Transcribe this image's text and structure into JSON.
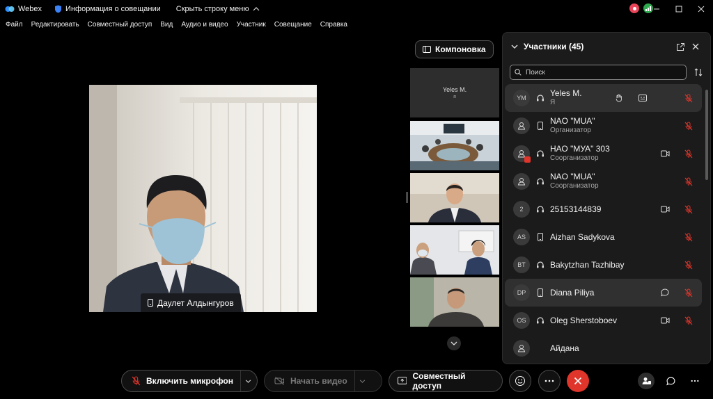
{
  "titlebar": {
    "app_name": "Webex",
    "meeting_info": "Информация о совещании",
    "hide_menu": "Скрыть строку меню"
  },
  "menu": [
    "Файл",
    "Редактировать",
    "Совместный доступ",
    "Вид",
    "Аудио и видео",
    "Участник",
    "Совещание",
    "Справка"
  ],
  "layout_button": "Компоновка",
  "main_video": {
    "name": "Даулет Алдынгуров"
  },
  "self_tile": {
    "name": "Yeles M.",
    "sub": "я"
  },
  "panel": {
    "title": "Участники (45)",
    "search_placeholder": "Поиск",
    "participants": [
      {
        "initials": "YM",
        "name": "Yeles M.",
        "role": "Я",
        "device": "headset-icon",
        "extras": [
          "hand-icon",
          "cc-icon"
        ],
        "video": false,
        "highlight": true
      },
      {
        "initials": "",
        "name": "NAO \"MUA\"",
        "role": "Организатор",
        "device": "phone-icon",
        "extras": [],
        "video": false,
        "highlight": false
      },
      {
        "initials": "",
        "name": "НАО \"МУА\" 303",
        "role": "Соорганизатор",
        "device": "headset-icon",
        "extras": [],
        "video": true,
        "highlight": false
      },
      {
        "initials": "",
        "name": "NAO \"MUA\"",
        "role": "Соорганизатор",
        "device": "headset-icon",
        "extras": [],
        "video": false,
        "highlight": false
      },
      {
        "initials": "2",
        "name": "25153144839",
        "role": "",
        "device": "headset-icon",
        "extras": [],
        "video": true,
        "highlight": false
      },
      {
        "initials": "AS",
        "name": "Aizhan Sadykova",
        "role": "",
        "device": "phone-icon",
        "extras": [],
        "video": false,
        "highlight": false
      },
      {
        "initials": "BT",
        "name": "Bakytzhan Tazhibay",
        "role": "",
        "device": "headset-icon",
        "extras": [],
        "video": false,
        "highlight": false
      },
      {
        "initials": "DP",
        "name": "Diana Piliya",
        "role": "",
        "device": "phone-icon",
        "extras": [],
        "chat": true,
        "video": false,
        "highlight": true
      },
      {
        "initials": "OS",
        "name": "Oleg Sherstoboev",
        "role": "",
        "device": "headset-icon",
        "extras": [],
        "video": true,
        "highlight": false
      },
      {
        "initials": "",
        "name": "Айдана",
        "role": "",
        "device": "",
        "extras": [],
        "video": false,
        "highlight": false
      }
    ]
  },
  "bottombar": {
    "mic": "Включить микрофон",
    "video": "Начать видео",
    "share": "Совместный доступ"
  },
  "colors": {
    "end_call": "#e0352b",
    "muted": "#e0352b",
    "panel_bg": "#1b1b1b"
  }
}
